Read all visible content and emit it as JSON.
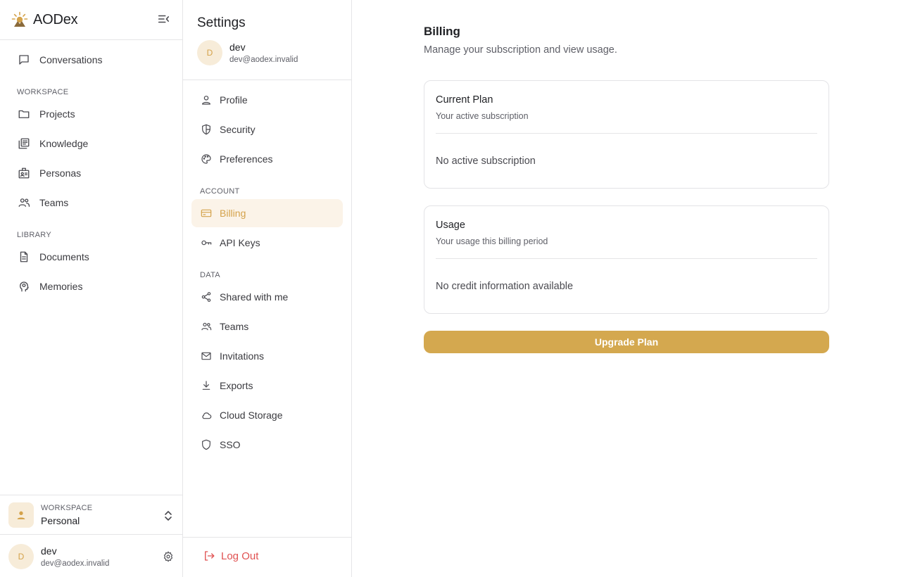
{
  "app": {
    "name": "AODex"
  },
  "sidebar": {
    "conversations_label": "Conversations",
    "workspace_section": "WORKSPACE",
    "workspace_items": [
      "Projects",
      "Knowledge",
      "Personas",
      "Teams"
    ],
    "library_section": "LIBRARY",
    "library_items": [
      "Documents",
      "Memories"
    ],
    "workspace_switcher": {
      "label": "WORKSPACE",
      "name": "Personal"
    },
    "user": {
      "initial": "D",
      "name": "dev",
      "email": "dev@aodex.invalid"
    }
  },
  "settings": {
    "title": "Settings",
    "user": {
      "initial": "D",
      "name": "dev",
      "email": "dev@aodex.invalid"
    },
    "general_items": [
      "Profile",
      "Security",
      "Preferences"
    ],
    "account_section": "ACCOUNT",
    "account_items": [
      "Billing",
      "API Keys"
    ],
    "data_section": "DATA",
    "data_items": [
      "Shared with me",
      "Teams",
      "Invitations",
      "Exports",
      "Cloud Storage",
      "SSO"
    ],
    "active_item": "Billing",
    "logout_label": "Log Out"
  },
  "main": {
    "title": "Billing",
    "subtitle": "Manage your subscription and view usage.",
    "current_plan": {
      "title": "Current Plan",
      "subtitle": "Your active subscription",
      "body": "No active subscription"
    },
    "usage": {
      "title": "Usage",
      "subtitle": "Your usage this billing period",
      "body": "No credit information available"
    },
    "upgrade_label": "Upgrade Plan"
  },
  "colors": {
    "accent": "#d4a84f",
    "accent_text": "#d4a24a",
    "active_bg": "#fbf3e8",
    "danger": "#e05151",
    "border": "#e5e5e7"
  }
}
